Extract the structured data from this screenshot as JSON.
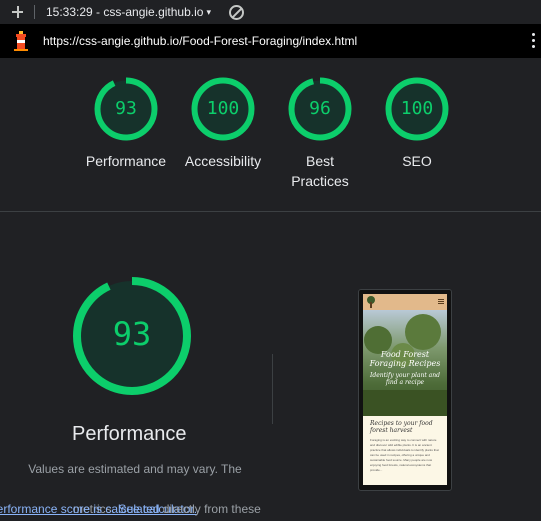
{
  "topbar": {
    "time_title": "15:33:29 - css-angie.github.io",
    "caret": "▾"
  },
  "urlbar": {
    "url": "https://css-angie.github.io/Food-Forest-Foraging/index.html"
  },
  "categories": [
    {
      "score": "93",
      "label_lines": [
        "Performance"
      ],
      "fraction": 0.93
    },
    {
      "score": "100",
      "label_lines": [
        "Accessibility"
      ],
      "fraction": 1.0
    },
    {
      "score": "96",
      "label_lines": [
        "Best",
        "Practices"
      ],
      "fraction": 0.96
    },
    {
      "score": "100",
      "label_lines": [
        "SEO"
      ],
      "fraction": 1.0
    }
  ],
  "performance": {
    "score": "93",
    "fraction": 0.93,
    "title": "Performance",
    "desc_line1": "Values are estimated and may vary. The",
    "desc_link1": "performance score is calculated",
    "desc_mid": " directly from these",
    "desc_line3_prefix": "metrics. ",
    "desc_link2": "See calculator."
  },
  "screenshot": {
    "hero_title": "Food Forest Foraging Recipes",
    "hero_subtitle": "Identify your plant and find a recipe",
    "card_title": "Recipes to your food forest harvest",
    "card_text": "Foraging is an exciting way to connect with nature and discover wild edible plants. It is an ancient practice that allows individuals to identify plants that can be used in recipes, offering a unique and sustainable food source. Many people are now enjoying food forests, natural ecosystems that provide..."
  },
  "colors": {
    "pass": "#0cce6b",
    "pass_bg": "#16322b",
    "background": "#202124"
  }
}
